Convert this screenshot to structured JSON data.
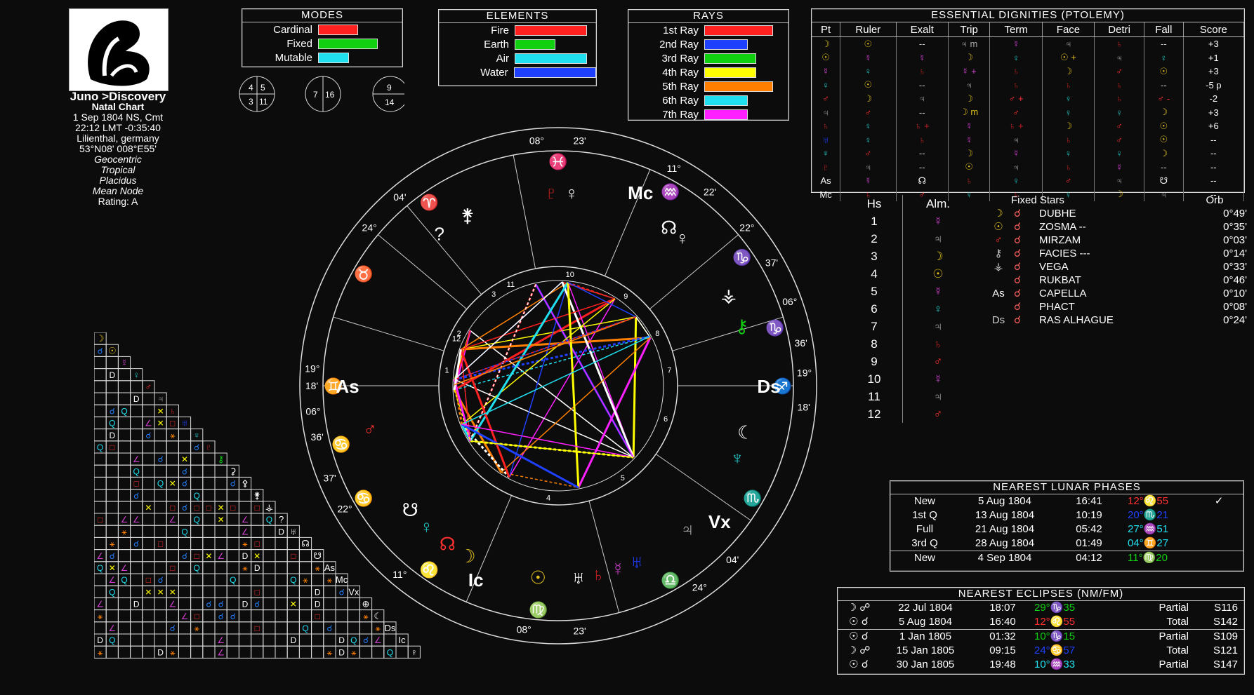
{
  "chart_info": {
    "name": "Juno >Discovery",
    "chart_type": "Natal Chart",
    "date": "1 Sep 1804 NS, Cmt",
    "time": "22:12  LMT -0:35:40",
    "place": "Lilienthal, germany",
    "coords": "53°N08' 008°E55'",
    "geo": "Geocentric",
    "zodiac": "Tropical",
    "houses": "Placidus",
    "node": "Mean Node",
    "rating": "Rating: A"
  },
  "modes": {
    "title": "MODES",
    "rows": [
      {
        "label": "Cardinal",
        "value": 0.5,
        "color": "#ff2020"
      },
      {
        "label": "Fixed",
        "value": 0.75,
        "color": "#10d010"
      },
      {
        "label": "Mutable",
        "value": 0.38,
        "color": "#20e0f0"
      }
    ]
  },
  "elements": {
    "title": "ELEMENTS",
    "rows": [
      {
        "label": "Fire",
        "value": 0.78,
        "color": "#ff2020"
      },
      {
        "label": "Earth",
        "value": 0.43,
        "color": "#10d010"
      },
      {
        "label": "Air",
        "value": 0.78,
        "color": "#20e0f0"
      },
      {
        "label": "Water",
        "value": 0.9,
        "color": "#2040ff"
      }
    ]
  },
  "rays": {
    "title": "RAYS",
    "rows": [
      {
        "label": "1st Ray",
        "value": 0.8,
        "color": "#ff2020"
      },
      {
        "label": "2nd Ray",
        "value": 0.5,
        "color": "#2040ff"
      },
      {
        "label": "3rd Ray",
        "value": 0.6,
        "color": "#10d010"
      },
      {
        "label": "4th Ray",
        "value": 0.6,
        "color": "#ffff00"
      },
      {
        "label": "5th Ray",
        "value": 0.8,
        "color": "#ff8000"
      },
      {
        "label": "6th Ray",
        "value": 0.5,
        "color": "#20e0f0"
      },
      {
        "label": "7th Ray",
        "value": 0.5,
        "color": "#ff20ff"
      }
    ]
  },
  "small_circles": [
    {
      "q": [
        "4",
        "5",
        "3",
        "11"
      ]
    },
    {
      "q": [
        "7",
        "16"
      ]
    },
    {
      "q": [
        "9",
        "14"
      ]
    }
  ],
  "dignities": {
    "title": "ESSENTIAL DIGNITIES (PTOLEMY)",
    "headers": [
      "Pt",
      "Ruler",
      "Exalt",
      "Trip",
      "Term",
      "Face",
      "Detri",
      "Fall",
      "Score"
    ],
    "rows": [
      [
        "☽",
        "☉",
        "--",
        "♃ m",
        "☿",
        "♃",
        "♄",
        "--",
        "+3"
      ],
      [
        "☉",
        "☿",
        "☿",
        "☽",
        "♀",
        "☉ +",
        "♃",
        "♀",
        "+1"
      ],
      [
        "☿",
        "♀",
        "♄",
        "☿ +",
        "♄",
        "☽",
        "♂",
        "☉",
        "+3"
      ],
      [
        "♀",
        "☉",
        "--",
        "♃",
        "♄",
        "♄",
        "♄",
        "--",
        "-5 p"
      ],
      [
        "♂",
        "☽",
        "♃",
        "☽",
        "♂ +",
        "♀",
        "♄",
        "♂ -",
        "-2"
      ],
      [
        "♃",
        "♂",
        "--",
        "☽ m",
        "♂",
        "♀",
        "♀",
        "☽",
        "+3"
      ],
      [
        "♄",
        "♀",
        "♄ +",
        "☿",
        "♄ +",
        "☽",
        "♂",
        "☉",
        "+6"
      ],
      [
        "♅",
        "♀",
        "♄",
        "☿",
        "♃",
        "♄",
        "♂",
        "☉",
        "--"
      ],
      [
        "♆",
        "♂",
        "--",
        "☽",
        "☿",
        "♀",
        "♀",
        "☽",
        "--"
      ],
      [
        "♇",
        "♃",
        "--",
        "☉",
        "♃",
        "♄",
        "☿",
        "--",
        "--"
      ],
      [
        "As",
        "☿",
        "☊",
        "♄",
        "♀",
        "♂",
        "♃",
        "☋",
        "--"
      ],
      [
        "Mc",
        "♄",
        "♂",
        "♀",
        "♄",
        "♀",
        "☽",
        "♃",
        "--"
      ]
    ]
  },
  "houses_table": {
    "col1": "Hs",
    "col2": "Alm.",
    "rows": [
      {
        "n": "1",
        "a": "☿",
        "c": "#d040d0"
      },
      {
        "n": "2",
        "a": "♃",
        "c": "#aaaaaa"
      },
      {
        "n": "3",
        "a": "☽",
        "c": "#e0c020"
      },
      {
        "n": "4",
        "a": "☉",
        "c": "#e0c020"
      },
      {
        "n": "5",
        "a": "☿",
        "c": "#d040d0"
      },
      {
        "n": "6",
        "a": "♀",
        "c": "#20c0c0"
      },
      {
        "n": "7",
        "a": "♃",
        "c": "#aaaaaa"
      },
      {
        "n": "8",
        "a": "♄",
        "c": "#c02020"
      },
      {
        "n": "9",
        "a": "♂",
        "c": "#ff3030"
      },
      {
        "n": "10",
        "a": "☿",
        "c": "#d040d0"
      },
      {
        "n": "11",
        "a": "♃",
        "c": "#aaaaaa"
      },
      {
        "n": "12",
        "a": "♂",
        "c": "#ff3030"
      }
    ]
  },
  "fixed_stars": {
    "title": "Fixed Stars",
    "orb_label": "Orb",
    "rows": [
      {
        "p": "☽",
        "a": "☌",
        "name": "DUBHE",
        "orb": "0°49'"
      },
      {
        "p": "☉",
        "a": "☌",
        "name": "ZOSMA --",
        "orb": "0°35'"
      },
      {
        "p": "♂",
        "a": "☌",
        "name": "MIRZAM",
        "orb": "0°03'"
      },
      {
        "p": "⚷",
        "a": "☌",
        "name": "FACIES ---",
        "orb": "0°14'"
      },
      {
        "p": "⚶",
        "a": "☌",
        "name": "VEGA",
        "orb": "0°33'"
      },
      {
        "p": "",
        "a": "☌",
        "name": "RUKBAT",
        "orb": "0°46'"
      },
      {
        "p": "As",
        "a": "☌",
        "name": "CAPELLA",
        "orb": "0°10'"
      },
      {
        "p": "",
        "a": "☌",
        "name": "PHACT",
        "orb": "0°08'"
      },
      {
        "p": "Ds",
        "a": "☌",
        "name": "RAS ALHAGUE",
        "orb": "0°24'"
      }
    ]
  },
  "lunar_phases": {
    "title": "NEAREST LUNAR PHASES",
    "rows": [
      {
        "phase": "New",
        "date": "5 Aug 1804",
        "time": "16:41",
        "pos": "12°♌55",
        "color": "#ff3030",
        "mark": "✓"
      },
      {
        "phase": "1st Q",
        "date": "13 Aug 1804",
        "time": "10:19",
        "pos": "20°♏21",
        "color": "#2040ff",
        "mark": ""
      },
      {
        "phase": "Full",
        "date": "21 Aug 1804",
        "time": "05:42",
        "pos": "27°♒51",
        "color": "#20e0f0",
        "mark": ""
      },
      {
        "phase": "3rd Q",
        "date": "28 Aug 1804",
        "time": "01:49",
        "pos": "04°♊27",
        "color": "#20e0f0",
        "mark": ""
      },
      {
        "phase": "New",
        "date": "4 Sep 1804",
        "time": "04:12",
        "pos": "11°♍20",
        "color": "#10d010",
        "mark": ""
      }
    ]
  },
  "eclipses": {
    "title": "NEAREST ECLIPSES (NM/FM)",
    "rows": [
      {
        "sym": "☽ ☍",
        "date": "22 Jul 1804",
        "time": "18:07",
        "pos": "29°♑35",
        "color": "#10d010",
        "type": "Partial",
        "saros": "S116"
      },
      {
        "sym": "☉ ☌",
        "date": "5 Aug 1804",
        "time": "16:40",
        "pos": "12°♌55",
        "color": "#ff3030",
        "type": "Total",
        "saros": "S142"
      },
      {
        "sym": "☉ ☌",
        "date": "1 Jan 1805",
        "time": "01:32",
        "pos": "10°♑15",
        "color": "#10d010",
        "type": "Partial",
        "saros": "S109"
      },
      {
        "sym": "☽ ☍",
        "date": "15 Jan 1805",
        "time": "09:15",
        "pos": "24°♋57",
        "color": "#2040ff",
        "type": "Total",
        "saros": "S121"
      },
      {
        "sym": "☉ ☌",
        "date": "30 Jan 1805",
        "time": "19:48",
        "pos": "10°♒33",
        "color": "#20e0f0",
        "type": "Partial",
        "saros": "S147"
      }
    ]
  },
  "wheel": {
    "outer_labels": [
      {
        "t": "08°",
        "a": 95
      },
      {
        "t": "23'",
        "a": 85
      },
      {
        "t": "11°",
        "a": 62
      },
      {
        "t": "22'",
        "a": 52
      },
      {
        "t": "22°",
        "a": 40
      },
      {
        "t": "37'",
        "a": 30
      },
      {
        "t": "06°",
        "a": 20
      },
      {
        "t": "36'",
        "a": 10
      },
      {
        "t": "19°",
        "a": 3
      },
      {
        "t": "18'",
        "a": -5
      },
      {
        "t": "04'",
        "a": -45
      },
      {
        "t": "24°",
        "a": -55
      },
      {
        "t": "23'",
        "a": -85
      },
      {
        "t": "08°",
        "a": -98
      },
      {
        "t": "11°",
        "a": -130
      },
      {
        "t": "22°",
        "a": -150
      },
      {
        "t": "37'",
        "a": -158
      },
      {
        "t": "36'",
        "a": -168
      },
      {
        "t": "06°",
        "a": -174
      },
      {
        "t": "18'",
        "a": -180
      },
      {
        "t": "19°",
        "a": 176
      },
      {
        "t": "24°",
        "a": 140
      },
      {
        "t": "04'",
        "a": 130
      }
    ],
    "signs": [
      {
        "g": "♓",
        "a": 90,
        "c": "#2040ff"
      },
      {
        "g": "♒",
        "a": 60,
        "c": "#20e0f0"
      },
      {
        "g": "♑",
        "a": 35,
        "c": "#10d010"
      },
      {
        "g": "♑",
        "a": 15,
        "c": "#10d010"
      },
      {
        "g": "♐",
        "a": 0,
        "c": "#ff3030"
      },
      {
        "g": "♏",
        "a": -30,
        "c": "#2040ff"
      },
      {
        "g": "♎",
        "a": -60,
        "c": "#20e0f0"
      },
      {
        "g": "♍",
        "a": -95,
        "c": "#10d010"
      },
      {
        "g": "♌",
        "a": -125,
        "c": "#ff3030"
      },
      {
        "g": "♋",
        "a": -150,
        "c": "#2040ff"
      },
      {
        "g": "♋",
        "a": -165,
        "c": "#2040ff"
      },
      {
        "g": "♊",
        "a": 180,
        "c": "#20e0f0"
      },
      {
        "g": "♉",
        "a": 150,
        "c": "#10d010"
      },
      {
        "g": "♈",
        "a": 125,
        "c": "#ff3030"
      }
    ],
    "house_numbers": [
      "1",
      "2",
      "3",
      "4",
      "5",
      "6",
      "7",
      "8",
      "9",
      "10",
      "11",
      "12"
    ],
    "angles": [
      {
        "t": "As",
        "a": 180,
        "c": "#ffffff"
      },
      {
        "t": "Ds",
        "a": 0,
        "c": "#ffffff"
      },
      {
        "t": "Mc",
        "a": 67,
        "c": "#ffffff"
      },
      {
        "t": "Ic",
        "a": -113,
        "c": "#ffffff"
      },
      {
        "t": "Vx",
        "a": -40,
        "c": "#ffffff"
      }
    ],
    "planets": [
      {
        "g": "☽",
        "a": -118,
        "c": "#e0c020"
      },
      {
        "g": "☉",
        "a": -96,
        "c": "#e0c020"
      },
      {
        "g": "♅",
        "a": -84,
        "c": "#ffffff"
      },
      {
        "g": "♄",
        "a": -78,
        "c": "#c02020"
      },
      {
        "g": "☿",
        "a": -72,
        "c": "#d040d0"
      },
      {
        "g": "♅",
        "a": -66,
        "c": "#2040ff"
      },
      {
        "g": "♃",
        "a": -48,
        "c": "#aaaaaa"
      },
      {
        "g": "♆",
        "a": -22,
        "c": "#20c0c0"
      },
      {
        "g": "☾",
        "a": -14,
        "c": "#ffffff"
      },
      {
        "g": "♀",
        "a": 50,
        "c": "#ffffff"
      },
      {
        "g": "☊",
        "a": 55,
        "c": "#ffffff"
      },
      {
        "g": "⚷",
        "a": 18,
        "c": "#10d010"
      },
      {
        "g": "⚶",
        "a": 28,
        "c": "#ffffff"
      },
      {
        "g": "♀",
        "a": 86,
        "c": "#ffffff"
      },
      {
        "g": "♇",
        "a": 92,
        "c": "#c02020"
      },
      {
        "g": "⚵",
        "a": 118,
        "c": "#ffffff"
      },
      {
        "g": "?",
        "a": 128,
        "c": "#ffffff"
      },
      {
        "g": "♂",
        "a": 193,
        "c": "#ff3030"
      },
      {
        "g": "☋",
        "a": -140,
        "c": "#ffffff"
      },
      {
        "g": "♀",
        "a": -133,
        "c": "#20c0c0"
      },
      {
        "g": "☊",
        "a": -125,
        "c": "#ff3030"
      }
    ]
  }
}
